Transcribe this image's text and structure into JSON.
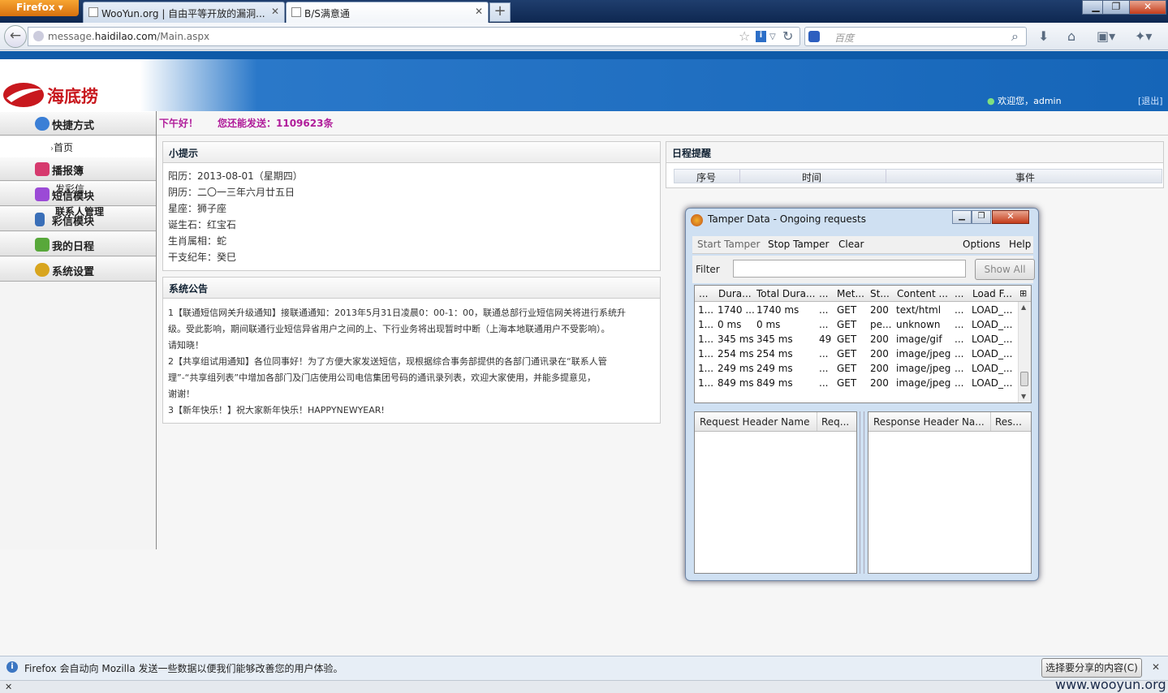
{
  "browser": {
    "menu_label": "Firefox",
    "tabs": [
      {
        "title": "WooYun.org | 自由平等开放的漏洞..."
      },
      {
        "title": "B/S满意通"
      }
    ],
    "url_prefix": "message.",
    "url_domain": "haidilao.com",
    "url_path": "/Main.aspx",
    "search_placeholder": "百度"
  },
  "site": {
    "logo_text": "海底捞",
    "welcome": "欢迎您，admin",
    "logout": "[退出]",
    "greeting": "下午好！",
    "remaining": "您还能发送：1109623条"
  },
  "sidebar": {
    "shortcut": "快捷方式",
    "home": "首页",
    "items": [
      {
        "label": "播报簿"
      },
      {
        "label": "短信模块"
      },
      {
        "label": "彩信模块"
      },
      {
        "label": "我的日程"
      },
      {
        "label": "系统设置"
      }
    ],
    "overlap": [
      "发彩信",
      "联系人管理"
    ]
  },
  "tips": {
    "title": "小提示",
    "lines": [
      "阳历：2013-08-01（星期四）",
      "阴历：二〇一三年六月廿五日",
      "星座：狮子座",
      "诞生石：红宝石",
      "生肖属相：蛇",
      "干支纪年：癸巳"
    ]
  },
  "notice": {
    "title": "系统公告",
    "lines": [
      "1【联通短信网关升级通知】接联通通知：2013年5月31日凌晨0：00-1：00，联通总部行业短信网关将进行系统升",
      "级。受此影响，期间联通行业短信异省用户之间的上、下行业务将出现暂时中断（上海本地联通用户不受影响）。",
      "请知晓！",
      "2【共享组试用通知】各位同事好！为了方便大家发送短信，现根据综合事务部提供的各部门通讯录在“联系人管",
      "理”-“共享组列表”中增加各部门及门店使用公司电信集团号码的通讯录列表，欢迎大家使用，并能多提意见，",
      "谢谢！",
      "3【新年快乐！】祝大家新年快乐！HAPPYNEWYEAR!"
    ]
  },
  "schedule": {
    "title": "日程提醒",
    "cols": [
      "序号",
      "时间",
      "事件"
    ]
  },
  "tamper": {
    "title": "Tamper Data - Ongoing requests",
    "menu": [
      "Start Tamper",
      "Stop Tamper",
      "Clear",
      "Options",
      "Help"
    ],
    "filter_label": "Filter",
    "show_all": "Show All",
    "columns": [
      "...",
      "Dura...",
      "Total Dura...",
      "...",
      "Met...",
      "St...",
      "Content ...",
      "...",
      "Load F..."
    ],
    "rows": [
      [
        "1...",
        "1740 ...",
        "1740 ms",
        "...",
        "GET",
        "200",
        "text/html",
        "...",
        "LOAD_..."
      ],
      [
        "1...",
        "0 ms",
        "0 ms",
        "...",
        "GET",
        "pe...",
        "unknown",
        "...",
        "LOAD_..."
      ],
      [
        "1...",
        "345 ms",
        "345 ms",
        "49",
        "GET",
        "200",
        "image/gif",
        "...",
        "LOAD_..."
      ],
      [
        "1...",
        "254 ms",
        "254 ms",
        "...",
        "GET",
        "200",
        "image/jpeg",
        "...",
        "LOAD_..."
      ],
      [
        "1...",
        "249 ms",
        "249 ms",
        "...",
        "GET",
        "200",
        "image/jpeg",
        "...",
        "LOAD_..."
      ],
      [
        "1...",
        "849 ms",
        "849 ms",
        "...",
        "GET",
        "200",
        "image/jpeg",
        "...",
        "LOAD_..."
      ]
    ],
    "req_header_name": "Request Header Name",
    "req_header_val": "Req...",
    "res_header_name": "Response Header Na...",
    "res_header_val": "Res..."
  },
  "notification": {
    "text": "Firefox 会自动向 Mozilla 发送一些数据以便我们能够改善您的用户体验。",
    "button": "选择要分享的内容(C)"
  },
  "watermark": "www.wooyun.org",
  "colors": {
    "brand_red": "#c8181e",
    "header_blue": "#1565b8",
    "greeting_purple": "#b01c9a"
  }
}
